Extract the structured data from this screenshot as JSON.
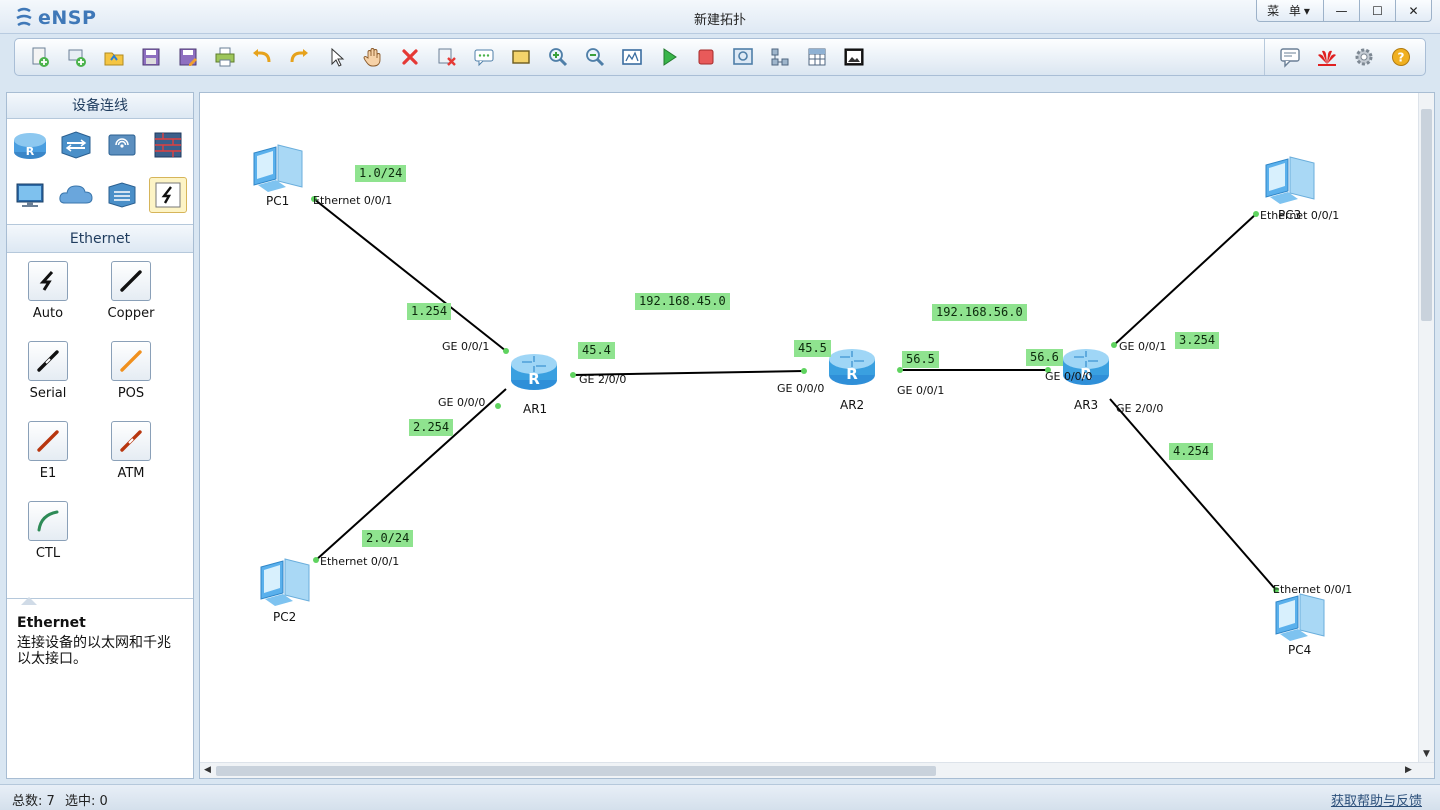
{
  "window": {
    "app_name": "eNSP",
    "title": "新建拓扑",
    "menu_label": "菜 单▾",
    "minimize": "—",
    "maximize": "☐",
    "close": "✕"
  },
  "toolbar": {
    "left_icons": [
      "new-topology-icon",
      "new-network-icon",
      "open-file-icon",
      "save-icon",
      "save-as-icon",
      "print-icon",
      "undo-icon",
      "redo-icon",
      "select-pointer-icon",
      "pan-hand-icon",
      "delete-icon",
      "delete-links-icon",
      "text-annotation-icon",
      "rectangle-annotation-icon",
      "zoom-in-icon",
      "zoom-out-icon",
      "fit-view-icon",
      "start-device-icon",
      "stop-device-icon",
      "capture-data-icon",
      "topology-icon",
      "grid-icon",
      "screenshot-icon"
    ],
    "right_icons": [
      "chat-icon",
      "huawei-logo-icon",
      "settings-icon",
      "help-icon"
    ]
  },
  "left_panel": {
    "section_title": "设备连线",
    "devices": [
      "router-icon",
      "switch-icon",
      "wireless-icon",
      "firewall-icon",
      "pc-icon",
      "cloud-icon",
      "other-device-icon",
      "cable-connector-icon"
    ],
    "cable_section_title": "Ethernet",
    "cables": [
      {
        "label": "Auto",
        "icon": "auto-cable-icon",
        "color": "#111111"
      },
      {
        "label": "Copper",
        "icon": "copper-cable-icon",
        "color": "#111111"
      },
      {
        "label": "Serial",
        "icon": "serial-cable-icon",
        "color": "#111111"
      },
      {
        "label": "POS",
        "icon": "pos-cable-icon",
        "color": "#f0901e"
      },
      {
        "label": "E1",
        "icon": "e1-cable-icon",
        "color": "#b8360f"
      },
      {
        "label": "ATM",
        "icon": "atm-cable-icon",
        "color": "#b8360f"
      },
      {
        "label": "CTL",
        "icon": "ctl-cable-icon",
        "color": "#2e8b57"
      }
    ],
    "info_title": "Ethernet",
    "info_desc": "连接设备的以太网和千兆以太接口。"
  },
  "topology": {
    "nodes": [
      {
        "id": "PC1",
        "label": "PC1",
        "type": "pc"
      },
      {
        "id": "PC2",
        "label": "PC2",
        "type": "pc"
      },
      {
        "id": "PC3",
        "label": "PC3",
        "type": "pc"
      },
      {
        "id": "PC4",
        "label": "PC4",
        "type": "pc"
      },
      {
        "id": "AR1",
        "label": "AR1",
        "type": "router"
      },
      {
        "id": "AR2",
        "label": "AR2",
        "type": "router"
      },
      {
        "id": "AR3",
        "label": "AR3",
        "type": "router"
      }
    ],
    "links": [
      {
        "a": "PC1",
        "a_port": "Ethernet 0/0/1",
        "b": "AR1",
        "b_port": "GE 0/0/1"
      },
      {
        "a": "PC2",
        "a_port": "Ethernet 0/0/1",
        "b": "AR1",
        "b_port": "GE 0/0/0"
      },
      {
        "a": "AR1",
        "a_port": "GE 2/0/0",
        "b": "AR2",
        "b_port": "GE 0/0/0"
      },
      {
        "a": "AR2",
        "a_port": "GE 0/0/1",
        "b": "AR3",
        "b_port": "GE 0/0/0"
      },
      {
        "a": "AR3",
        "a_port": "GE 0/0/1",
        "b": "PC3",
        "b_port": "Ethernet 0/0/1"
      },
      {
        "a": "AR3",
        "a_port": "GE 2/0/0",
        "b": "PC4",
        "b_port": "Ethernet 0/0/1"
      }
    ],
    "annotations": [
      "1.0/24",
      "1.254",
      "2.254",
      "2.0/24",
      "192.168.45.0",
      "45.4",
      "45.5",
      "56.5",
      "192.168.56.0",
      "56.6",
      "3.254",
      "4.254"
    ]
  },
  "status": {
    "total_label": "总数: 7",
    "selected_label": "选中: 0",
    "help_link": "获取帮助与反馈"
  },
  "colors": {
    "tag_bg": "#8fe38f",
    "port_dot": "#5fd35f",
    "router_blue": "#3aa0e0"
  }
}
